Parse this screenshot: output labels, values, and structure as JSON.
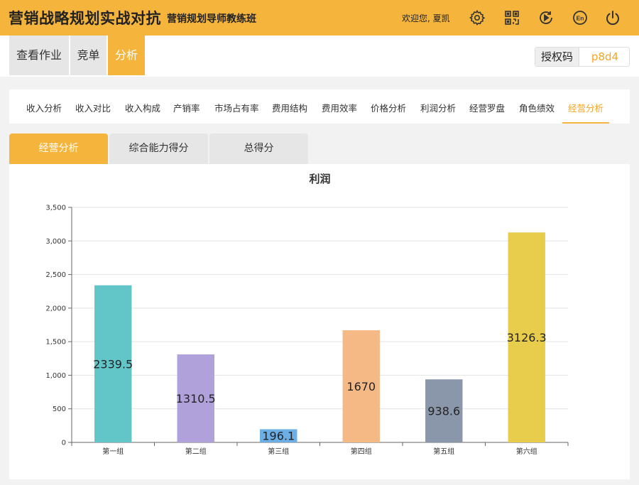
{
  "header": {
    "title": "营销战略规划实战对抗",
    "subtitle": "营销规划导师教练班",
    "welcome": "欢迎您, 夏凯",
    "icons": [
      "gear-icon",
      "qr-code-icon",
      "play-icon",
      "language-en-icon",
      "power-icon"
    ],
    "en_label": "En",
    "color": "#f5b43c"
  },
  "nav": {
    "tabs": [
      {
        "label": "查看作业",
        "active": false
      },
      {
        "label": "竞单",
        "active": false
      },
      {
        "label": "分析",
        "active": true
      }
    ],
    "auth_label": "授权码",
    "auth_code": "p8d4"
  },
  "subnav": {
    "tabs": [
      "收入分析",
      "收入对比",
      "收入构成",
      "产销率",
      "市场占有率",
      "费用结构",
      "费用效率",
      "价格分析",
      "利润分析",
      "经营罗盘",
      "角色绩效",
      "经营分析"
    ],
    "active_index": 11
  },
  "panel_tabs": {
    "tabs": [
      {
        "label": "经营分析",
        "active": true
      },
      {
        "label": "综合能力得分",
        "active": false
      },
      {
        "label": "总得分",
        "active": false
      }
    ]
  },
  "chart_data": {
    "type": "bar",
    "title": "利润",
    "categories": [
      "第一组",
      "第二组",
      "第三组",
      "第四组",
      "第五组",
      "第六组"
    ],
    "values": [
      2339.5,
      1310.5,
      196.1,
      1670,
      938.6,
      3126.3
    ],
    "value_labels": [
      "2339.5",
      "1310.5",
      "196.1",
      "1670",
      "938.6",
      "3126.3"
    ],
    "colors": [
      "#62c6c8",
      "#b1a1da",
      "#6bafe6",
      "#f5b986",
      "#8a97ab",
      "#e8cd4c"
    ],
    "ylim": [
      0,
      3500
    ],
    "yticks": [
      0,
      500,
      1000,
      1500,
      2000,
      2500,
      3000,
      3500
    ],
    "ytick_labels": [
      "0",
      "500",
      "1,000",
      "1,500",
      "2,000",
      "2,500",
      "3,000",
      "3,500"
    ],
    "grid": true,
    "xlabel": "",
    "ylabel": ""
  }
}
